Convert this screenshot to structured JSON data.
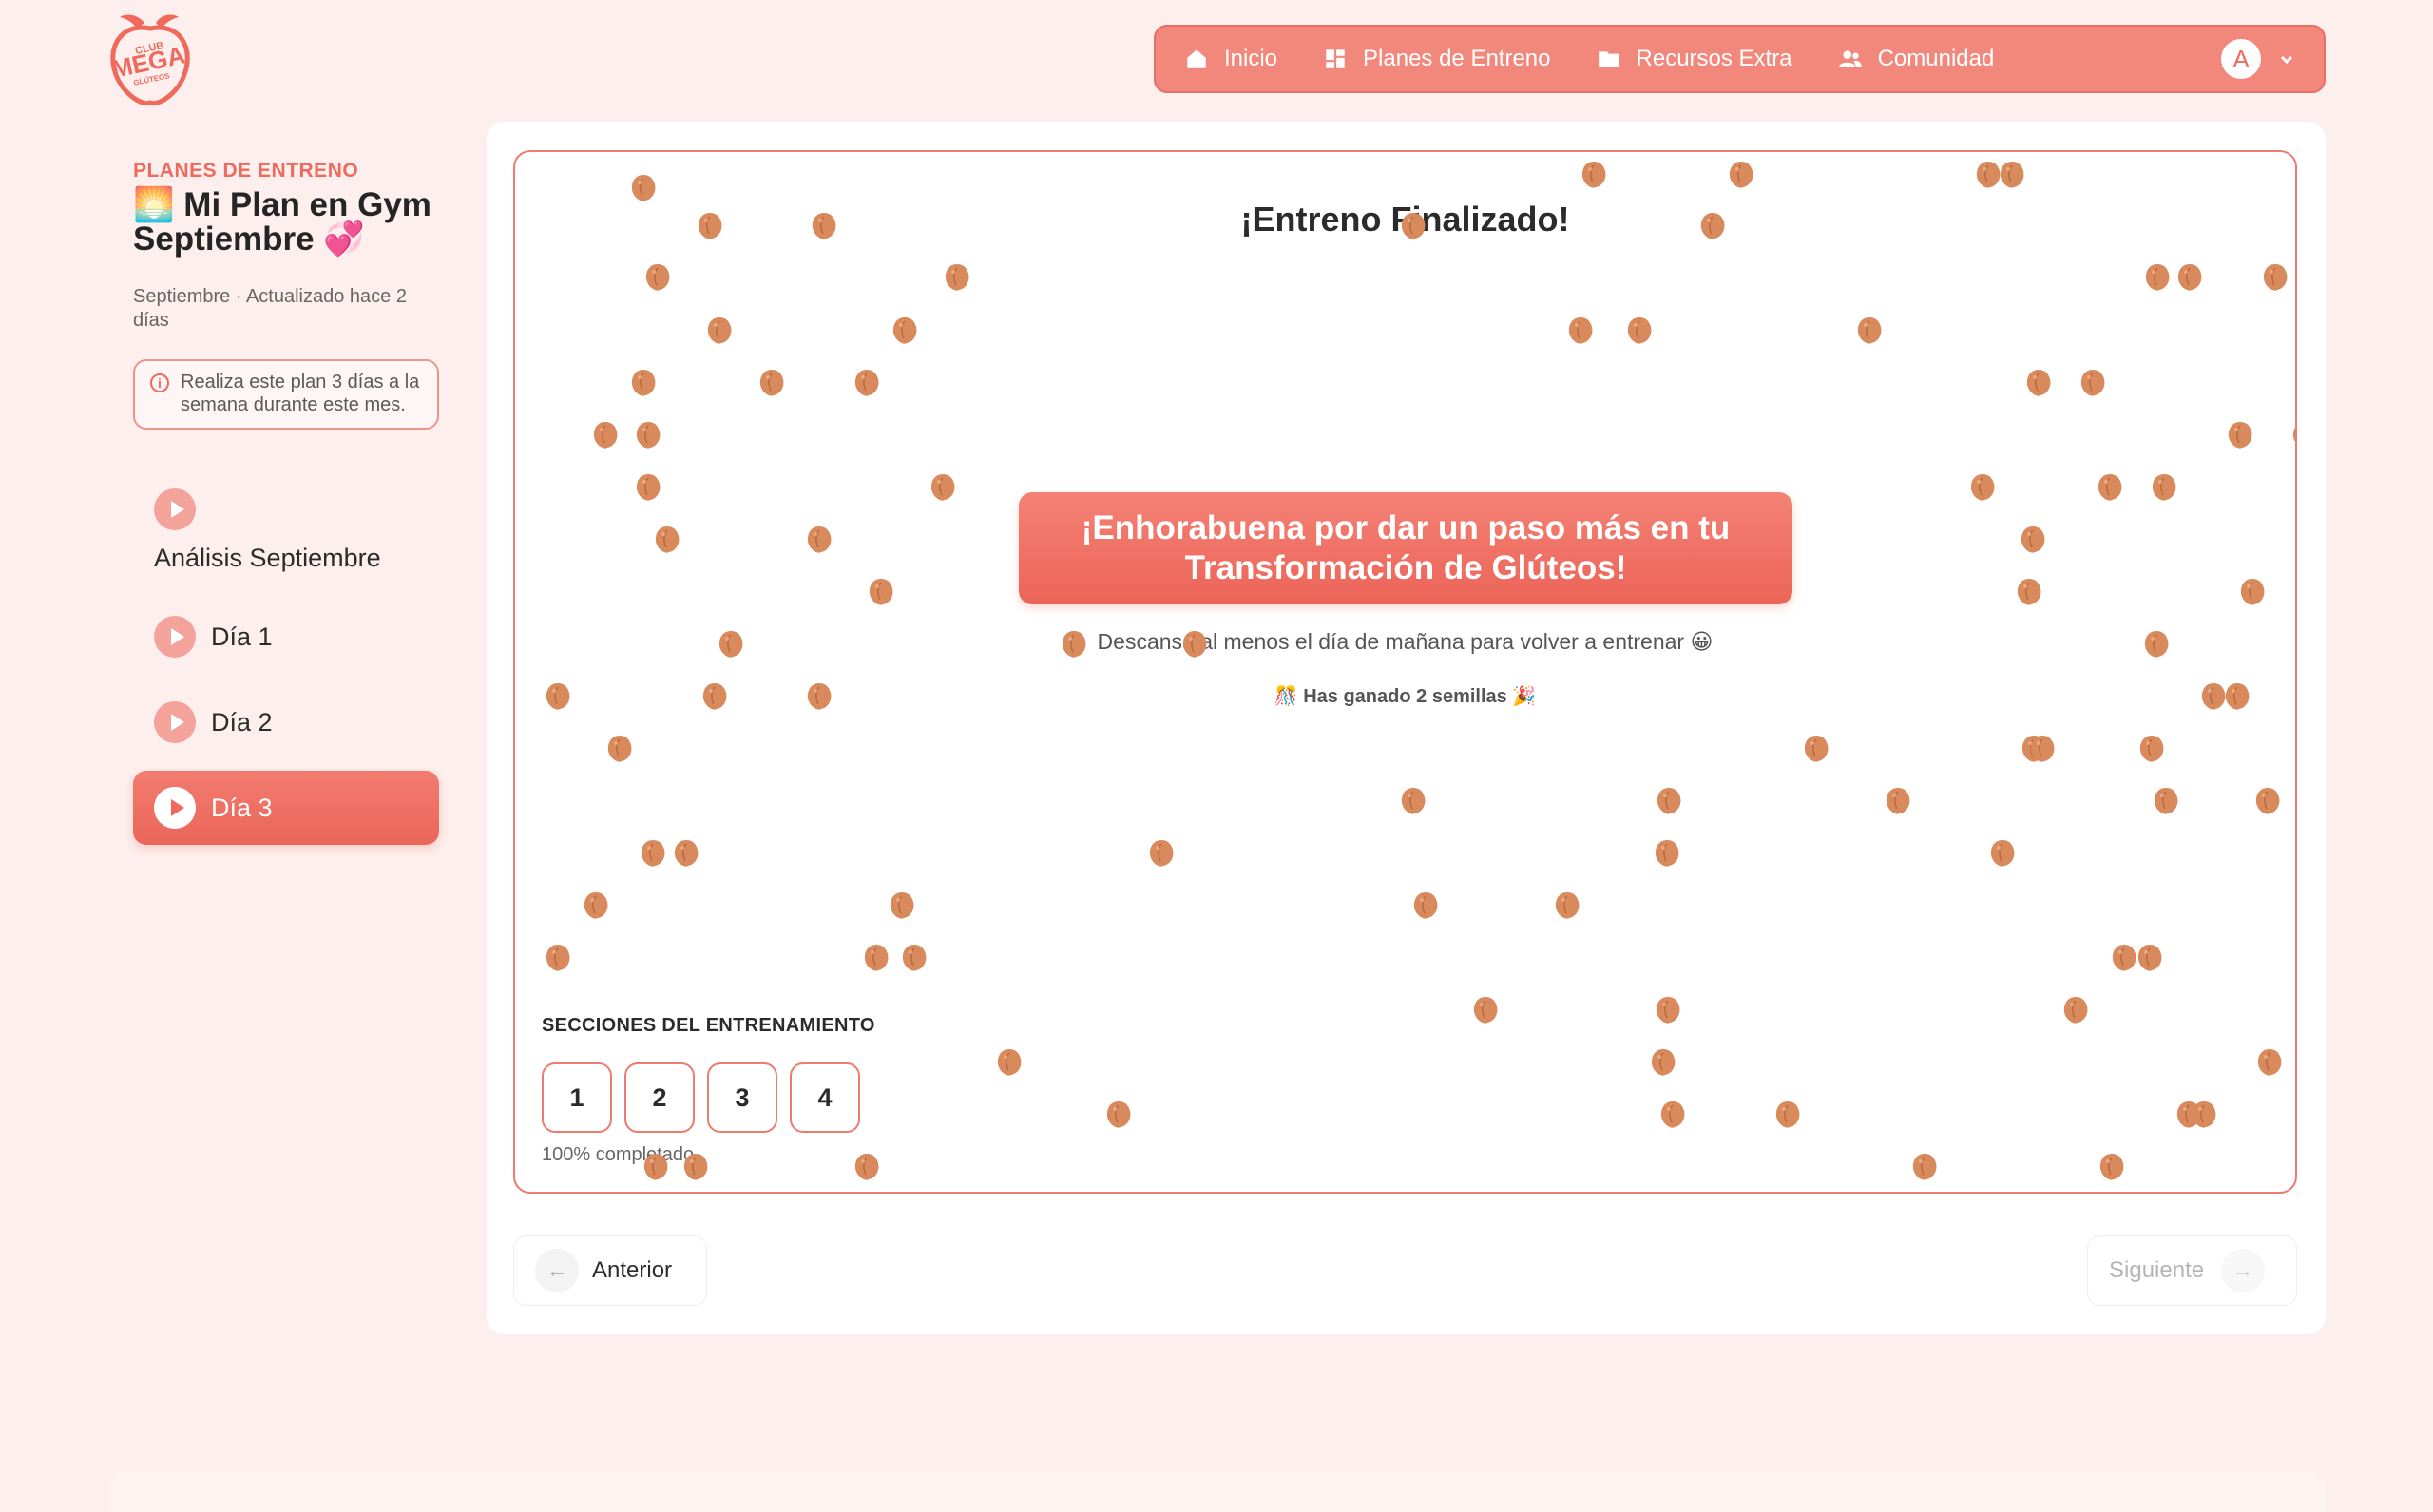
{
  "brand": {
    "logo_text_top": "CLUB",
    "logo_text_main": "MEGA",
    "logo_text_bottom": "GLÚTEOS"
  },
  "nav": {
    "items": [
      {
        "label": "Inicio",
        "icon": "home-icon"
      },
      {
        "label": "Planes de Entreno",
        "icon": "dashboard-icon"
      },
      {
        "label": "Recursos Extra",
        "icon": "folder-icon"
      },
      {
        "label": "Comunidad",
        "icon": "users-icon"
      }
    ],
    "avatar_initial": "A",
    "colors": {
      "bar": "#f2877c",
      "accent": "#ef6a5c"
    }
  },
  "sidebar": {
    "kicker": "PLANES DE ENTRENO",
    "title": "🌅 Mi Plan en Gym Septiembre 💞",
    "meta": "Septiembre · Actualizado hace 2 días",
    "note": "Realiza este plan 3 días a la semana durante este mes.",
    "items": [
      {
        "label": "Análisis Septiembre",
        "active": false
      },
      {
        "label": "Día 1",
        "active": false
      },
      {
        "label": "Día 2",
        "active": false
      },
      {
        "label": "Día 3",
        "active": true
      }
    ]
  },
  "main": {
    "title": "¡Entreno Finalizado!",
    "banner": "¡Enhorabuena por dar un paso más en tu Transformación de Glúteos!",
    "rest_message": "Descansa al menos el día de mañana para volver a entrenar 😀",
    "seeds_message": "🎊 Has ganado 2 semillas 🎉",
    "sections_label": "SECCIONES DEL ENTRENAMIENTO",
    "sections": [
      "1",
      "2",
      "3",
      "4"
    ],
    "progress": "100% completado",
    "progress_value": 100,
    "prev_label": "Anterior",
    "next_label": "Siguiente"
  }
}
